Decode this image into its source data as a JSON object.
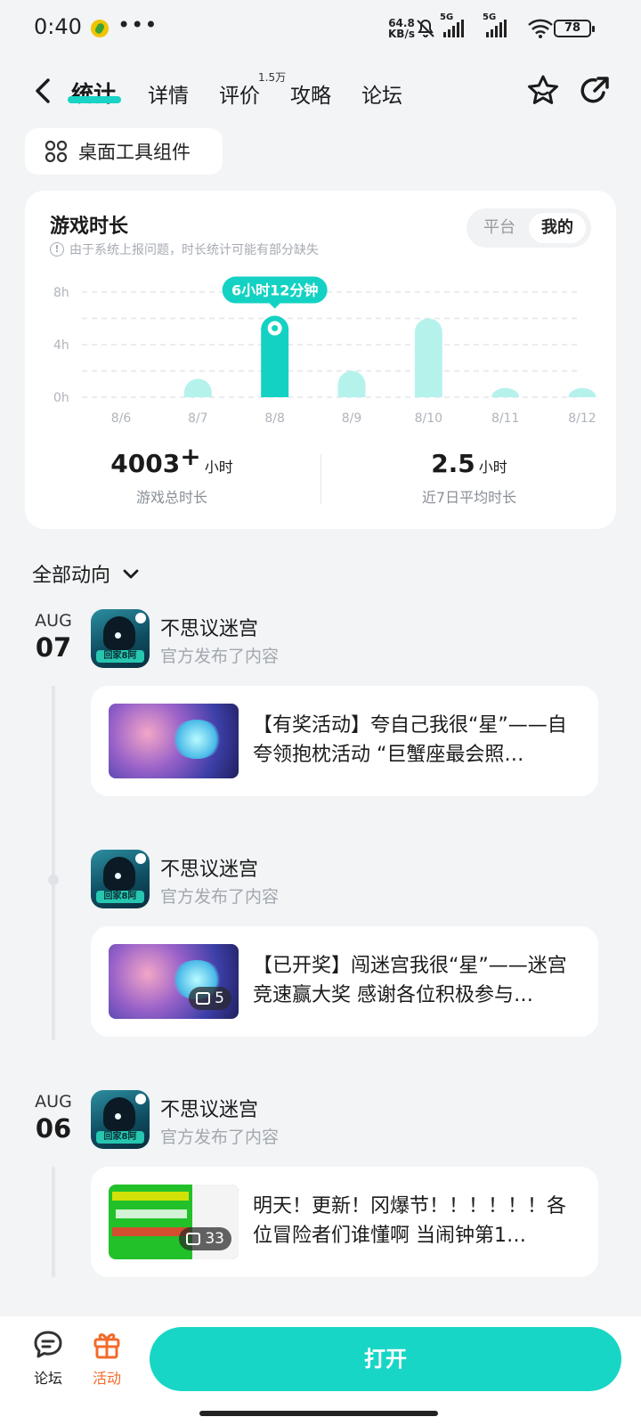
{
  "status_bar": {
    "time": "0:40",
    "more": "•••",
    "net_speed_value": "64.8",
    "net_speed_unit": "KB/s",
    "sim1": "5G",
    "sim2": "5G",
    "battery": "78"
  },
  "nav": {
    "tabs": [
      {
        "label": "统计",
        "active": true
      },
      {
        "label": "详情",
        "active": false
      },
      {
        "label": "评价",
        "active": false
      },
      {
        "label": "攻略",
        "active": false
      },
      {
        "label": "论坛",
        "active": false
      }
    ],
    "review_badge": "1.5万",
    "icons": [
      "back-icon",
      "star-icon",
      "share-icon"
    ]
  },
  "widget_button": {
    "label": "桌面工具组件",
    "icon": "grid-icon"
  },
  "stats": {
    "title": "游戏时长",
    "note": "由于系统上报问题，时长统计可能有部分缺失",
    "segment_options": [
      "平台",
      "我的"
    ],
    "segment_selected": "我的",
    "total_value": "4003",
    "total_plus": "+",
    "total_unit": "小时",
    "total_label": "游戏总时长",
    "avg_value": "2.5",
    "avg_unit": "小时",
    "avg_label": "近7日平均时长",
    "accent": "#19d3c5"
  },
  "chart_data": {
    "type": "bar",
    "categories": [
      "8/6",
      "8/7",
      "8/8",
      "8/9",
      "8/10",
      "8/11",
      "8/12"
    ],
    "values": [
      0,
      1.4,
      6.2,
      2.0,
      6.0,
      0.7,
      0.7
    ],
    "y_ticks": [
      "8h",
      "4h",
      "0h"
    ],
    "ylim": [
      0,
      8
    ],
    "grid": true,
    "selected_category": "8/8",
    "tooltip": "6小时12分钟",
    "colors": {
      "selected": "#14d2c3",
      "default": "#b6f2ec"
    }
  },
  "feed": {
    "filter_label": "全部动向",
    "groups": [
      {
        "month": "AUG",
        "day": "07",
        "posts": [
          {
            "game": "不思议迷宫",
            "action": "官方发布了内容",
            "icon_tag": "回家8阿",
            "title": "【有奖活动】夸自己我很“星”——自夸领抱枕活动 “巨蟹座最会照…",
            "image_count": ""
          },
          {
            "game": "不思议迷宫",
            "action": "官方发布了内容",
            "icon_tag": "回家8阿",
            "title": "【已开奖】闯迷宫我很“星”——迷宫竞速赢大奖 感谢各位积极参与…",
            "image_count": "5"
          }
        ]
      },
      {
        "month": "AUG",
        "day": "06",
        "posts": [
          {
            "game": "不思议迷宫",
            "action": "官方发布了内容",
            "icon_tag": "回家8阿",
            "title": "明天！更新！冈爆节！！！！！！各位冒险者们谁懂啊 当闹钟第1…",
            "image_count": "33"
          }
        ]
      }
    ]
  },
  "bottom_bar": {
    "forum_label": "论坛",
    "activity_label": "活动",
    "open_label": "打开",
    "activity_color": "#f26b2b"
  }
}
